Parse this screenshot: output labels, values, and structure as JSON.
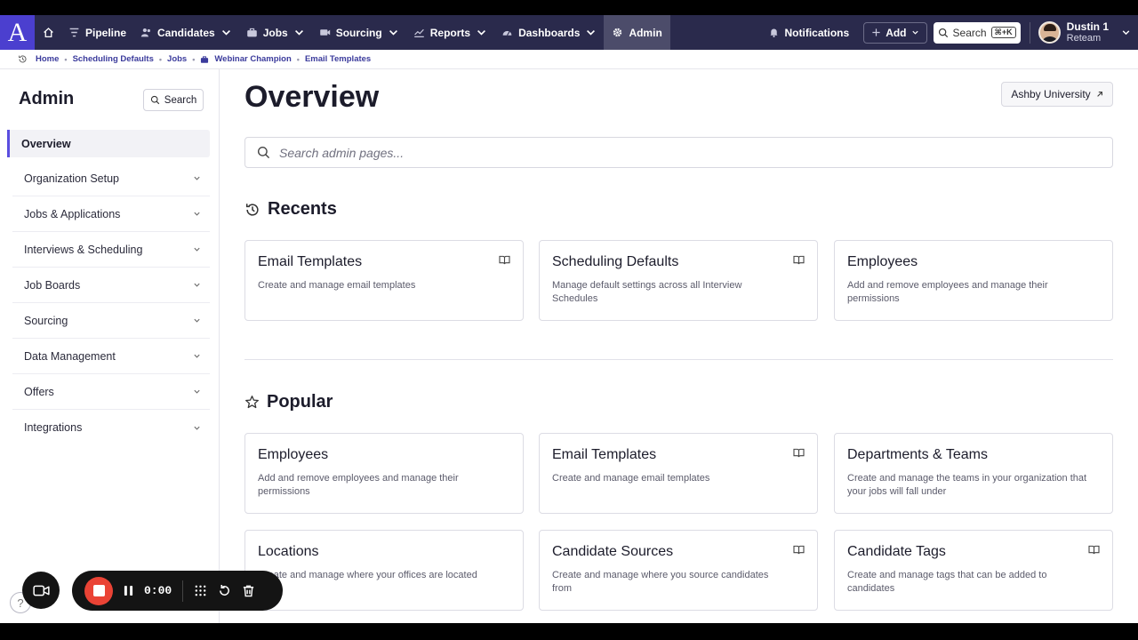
{
  "nav": {
    "logo": "A",
    "items": [
      {
        "label": "Pipeline"
      },
      {
        "label": "Candidates"
      },
      {
        "label": "Jobs"
      },
      {
        "label": "Sourcing"
      },
      {
        "label": "Reports"
      },
      {
        "label": "Dashboards"
      },
      {
        "label": "Admin"
      }
    ],
    "notifications": "Notifications",
    "add": "Add",
    "search": "Search",
    "shortcut": "⌘+K",
    "user_name": "Dustin 1",
    "user_org": "Reteam"
  },
  "breadcrumb": [
    "Home",
    "Scheduling Defaults",
    "Jobs",
    "Webinar Champion",
    "Email Templates"
  ],
  "sidebar": {
    "title": "Admin",
    "search": "Search",
    "items": [
      {
        "label": "Overview"
      },
      {
        "label": "Organization Setup"
      },
      {
        "label": "Jobs & Applications"
      },
      {
        "label": "Interviews & Scheduling"
      },
      {
        "label": "Job Boards"
      },
      {
        "label": "Sourcing"
      },
      {
        "label": "Data Management"
      },
      {
        "label": "Offers"
      },
      {
        "label": "Integrations"
      }
    ]
  },
  "main": {
    "title": "Overview",
    "university_button": "Ashby University",
    "search_placeholder": "Search admin pages...",
    "recents_title": "Recents",
    "popular_title": "Popular",
    "recents": [
      {
        "title": "Email Templates",
        "desc": "Create and manage email templates"
      },
      {
        "title": "Scheduling Defaults",
        "desc": "Manage default settings across all Interview Schedules"
      },
      {
        "title": "Employees",
        "desc": "Add and remove employees and manage their permissions"
      }
    ],
    "popular": [
      {
        "title": "Employees",
        "desc": "Add and remove employees and manage their permissions"
      },
      {
        "title": "Email Templates",
        "desc": "Create and manage email templates"
      },
      {
        "title": "Departments & Teams",
        "desc": "Create and manage the teams in your organization that your jobs will fall under"
      },
      {
        "title": "Locations",
        "desc": "Create and manage where your offices are located"
      },
      {
        "title": "Candidate Sources",
        "desc": "Create and manage where you source candidates from"
      },
      {
        "title": "Candidate Tags",
        "desc": "Create and manage tags that can be added to candidates"
      }
    ]
  },
  "recorder": {
    "time": "0:00"
  },
  "help": "?",
  "colors": {
    "nav_bg": "#2a2a4c",
    "logo_bg": "#4b3fcf",
    "accent": "#5a4ee0",
    "record": "#ea4335"
  }
}
